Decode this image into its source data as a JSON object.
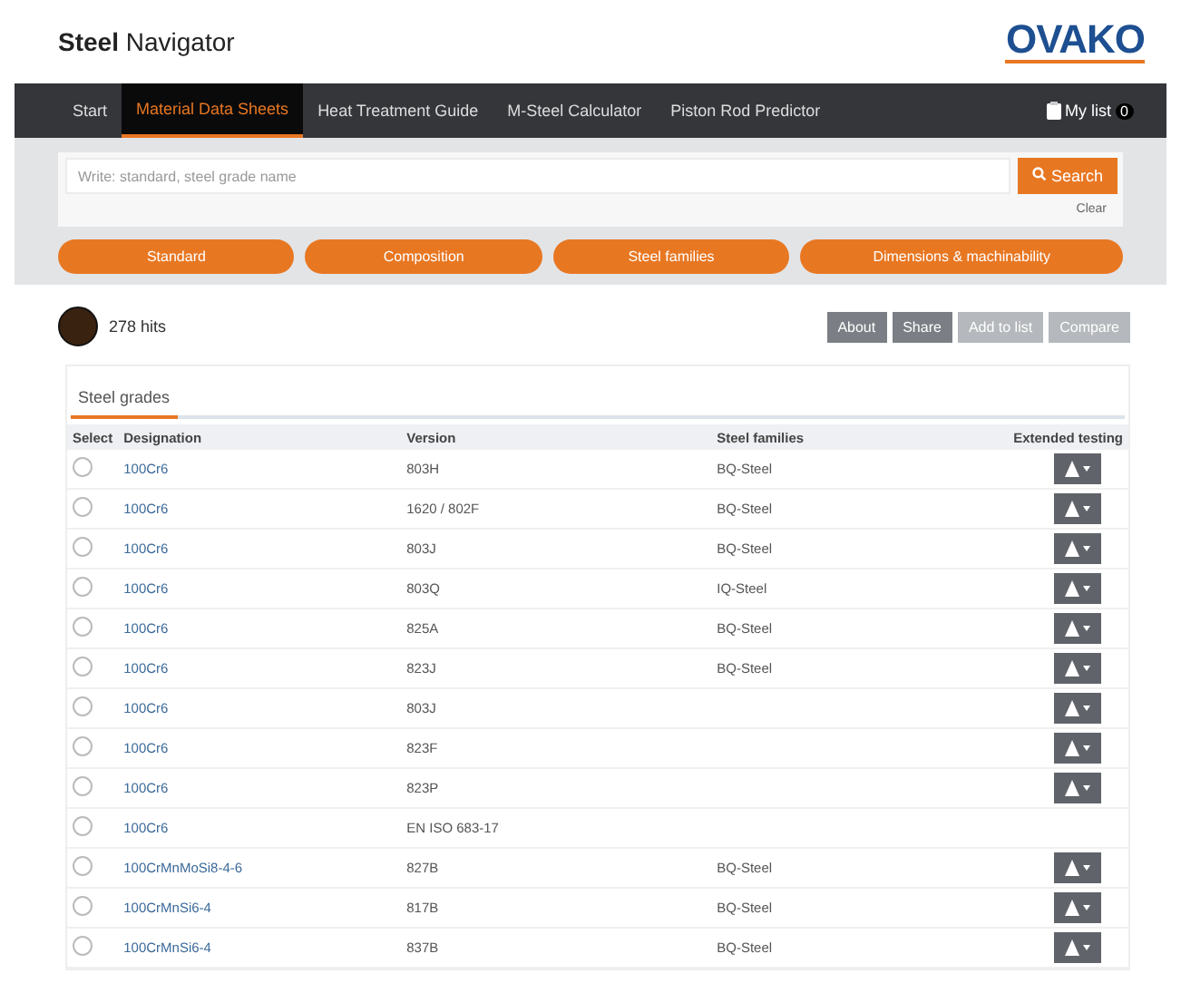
{
  "header": {
    "title_bold": "Steel",
    "title_rest": "Navigator",
    "logo": "OVAKO"
  },
  "nav": {
    "items": [
      {
        "label": "Start",
        "selected": false
      },
      {
        "label": "Material Data Sheets",
        "selected": true
      },
      {
        "label": "Heat Treatment Guide",
        "selected": false
      },
      {
        "label": "M-Steel Calculator",
        "selected": false
      },
      {
        "label": "Piston Rod Predictor",
        "selected": false
      }
    ],
    "my_list": "My list",
    "my_list_count": "0"
  },
  "search": {
    "placeholder": "Write: standard, steel grade name",
    "button": "Search",
    "clear": "Clear"
  },
  "filters": [
    "Standard",
    "Composition",
    "Steel families",
    "Dimensions & machinability"
  ],
  "hits": "278 hits",
  "actions": [
    {
      "label": "About",
      "disabled": false
    },
    {
      "label": "Share",
      "disabled": false
    },
    {
      "label": "Add to list",
      "disabled": true
    },
    {
      "label": "Compare",
      "disabled": true
    }
  ],
  "tabs": [
    {
      "label": "Steel grades",
      "selected": true
    }
  ],
  "table": {
    "columns": [
      "Select",
      "Designation",
      "Version",
      "Steel families",
      "Extended testing"
    ],
    "rows": [
      {
        "checked": false,
        "designation": "100Cr6",
        "version": "803H",
        "family": "BQ-Steel",
        "download": true
      },
      {
        "checked": false,
        "designation": "100Cr6",
        "version": "1620 / 802F",
        "family": "BQ-Steel",
        "download": true
      },
      {
        "checked": false,
        "designation": "100Cr6",
        "version": "803J",
        "family": "BQ-Steel",
        "download": true
      },
      {
        "checked": false,
        "designation": "100Cr6",
        "version": "803Q",
        "family": "IQ-Steel",
        "download": true
      },
      {
        "checked": false,
        "designation": "100Cr6",
        "version": "825A",
        "family": "BQ-Steel",
        "download": true
      },
      {
        "checked": false,
        "designation": "100Cr6",
        "version": "823J",
        "family": "BQ-Steel",
        "download": true
      },
      {
        "checked": false,
        "designation": "100Cr6",
        "version": "803J",
        "download": true
      },
      {
        "checked": false,
        "designation": "100Cr6",
        "version": "823F",
        "download": true
      },
      {
        "checked": false,
        "designation": "100Cr6",
        "version": "823P",
        "download": true
      },
      {
        "checked": false,
        "designation": "100Cr6",
        "version": "EN ISO 683-17",
        "download": false
      },
      {
        "checked": false,
        "designation": "100CrMnMoSi8-4-6",
        "version": "827B",
        "family": "BQ-Steel",
        "download": true
      },
      {
        "checked": false,
        "designation": "100CrMnSi6-4",
        "version": "817B",
        "family": "BQ-Steel",
        "download": true
      },
      {
        "checked": false,
        "designation": "100CrMnSi6-4",
        "version": "837B",
        "family": "BQ-Steel",
        "download": true
      }
    ]
  }
}
